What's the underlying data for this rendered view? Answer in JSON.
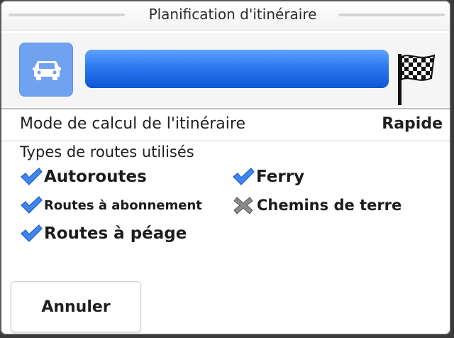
{
  "dialog": {
    "title": "Planification d'itinéraire"
  },
  "progress": {
    "value_fraction": 1.0,
    "vehicle_icon": "car-icon",
    "destination_icon": "checkered-flag-icon",
    "colors": {
      "fill": "#2d79ee",
      "vehicle_button": "#6fa2f1"
    }
  },
  "route_mode": {
    "label": "Mode de calcul de l'itinéraire",
    "value": "Rapide"
  },
  "road_types": {
    "heading": "Types de routes utilisés",
    "items": [
      {
        "label": "Autoroutes",
        "enabled": true,
        "icon": "checkmark-icon"
      },
      {
        "label": "Ferry",
        "enabled": true,
        "icon": "checkmark-icon"
      },
      {
        "label": "Routes à abonnement",
        "enabled": true,
        "icon": "checkmark-icon"
      },
      {
        "label": "Chemins de terre",
        "enabled": false,
        "icon": "cross-icon"
      },
      {
        "label": "Routes à péage",
        "enabled": true,
        "icon": "checkmark-icon"
      }
    ]
  },
  "actions": {
    "cancel_label": "Annuler"
  },
  "colors": {
    "check": "#3f86ee",
    "cross": "#8a8a8a"
  }
}
